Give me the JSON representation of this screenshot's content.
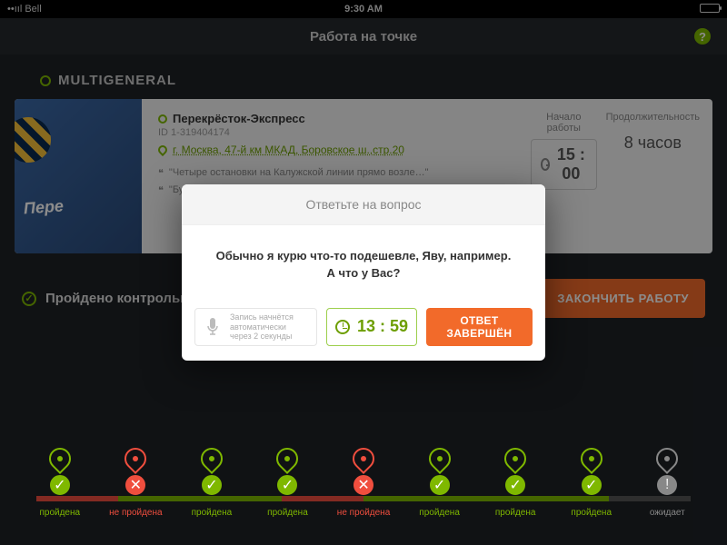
{
  "statusbar": {
    "carrier": "Bell",
    "time": "9:30 AM"
  },
  "navbar": {
    "title": "Работа на точке"
  },
  "section": "MULTIGENERAL",
  "card": {
    "sign": "Пере",
    "name": "Перекрёсток-Экспресс",
    "id": "ID 1-319404174",
    "address": "г. Москва, 47-й км МКАД, Боровское ш.,стр.20",
    "note1": "\"Четыре остановки на Калужской линии прямо возле…\"",
    "note2": "\"Будьте акк…\"",
    "start_label": "Начало работы",
    "start_time": "15 : 00",
    "duration_label": "Продолжительность",
    "duration": "8 часов"
  },
  "mid": {
    "progress": "Пройдено контрольных точ",
    "end_button": "ЗАКОНЧИТЬ РАБОТУ"
  },
  "steps": [
    {
      "status": "ok",
      "label": "пройдена",
      "seg_color": "#f04e3e"
    },
    {
      "status": "fail",
      "label": "не пройдена",
      "seg_color": "#7fb800"
    },
    {
      "status": "ok",
      "label": "пройдена",
      "seg_color": "#7fb800"
    },
    {
      "status": "ok",
      "label": "пройдена",
      "seg_color": "#f04e3e"
    },
    {
      "status": "fail",
      "label": "не пройдена",
      "seg_color": "#7fb800"
    },
    {
      "status": "ok",
      "label": "пройдена",
      "seg_color": "#7fb800"
    },
    {
      "status": "ok",
      "label": "пройдена",
      "seg_color": "#7fb800"
    },
    {
      "status": "ok",
      "label": "пройдена",
      "seg_color": "#555"
    },
    {
      "status": "wait",
      "label": "ожидает",
      "seg_color": null
    }
  ],
  "modal": {
    "title": "Ответьте на вопрос",
    "question_l1": "Обычно я курю что-то подешевле, Яву, например.",
    "question_l2": "А что у Вас?",
    "rec_l1": "Запись начнётся",
    "rec_l2": "автоматически",
    "rec_l3": "через 2 секунды",
    "timer": "13 : 59",
    "done": "ОТВЕТ ЗАВЕРШЁН"
  }
}
